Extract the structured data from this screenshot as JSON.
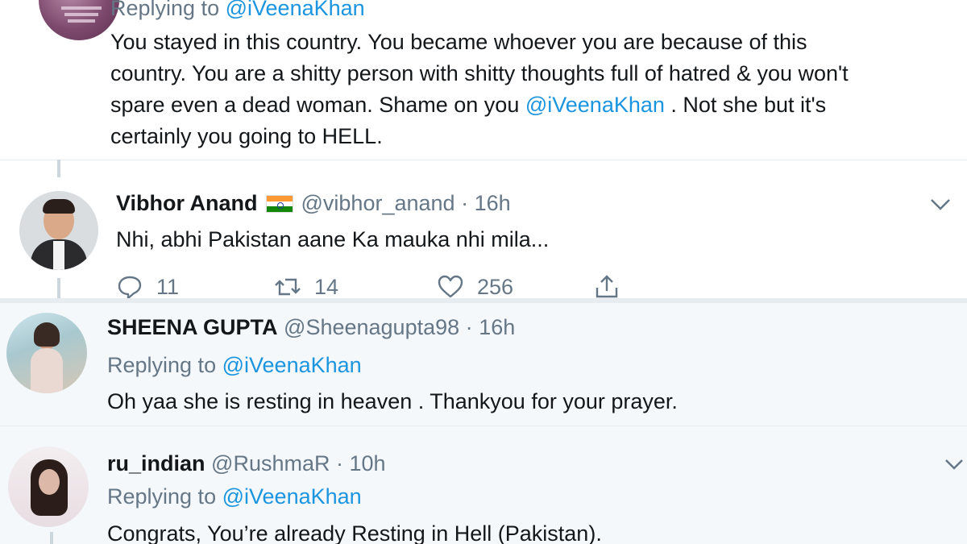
{
  "top_tweet": {
    "replying_prefix": "Replying to",
    "replying_handle": "@iVeenaKhan",
    "text_lines": [
      "You stayed in this country. You became whoever you are because of this",
      "country. You are a shitty person with shitty thoughts full of hatred & you won't",
      "spare even a dead woman. Shame on you ",
      "@iVeenaKhan",
      " . Not she but it's",
      "certainly you going to HELL."
    ]
  },
  "nested_reply": {
    "name": "Vibhor Anand",
    "handle": "@vibhor_anand",
    "separator": "·",
    "time": "16h",
    "text": "Nhi, abhi Pakistan aane Ka mauka nhi mila...",
    "replies": "11",
    "retweets": "14",
    "likes": "256",
    "flag_icon": "india-flag-icon"
  },
  "sheena_tweet": {
    "name": "SHEENA GUPTA",
    "handle": "@Sheenagupta98",
    "separator": "·",
    "time": "16h",
    "replying_prefix": "Replying to",
    "replying_handle": "@iVeenaKhan",
    "text": "Oh yaa she is resting in heaven . Thankyou for your prayer."
  },
  "rushma_tweet": {
    "name": "ru_indian",
    "handle": "@RushmaR",
    "separator": "·",
    "time": "10h",
    "replying_prefix": "Replying to",
    "replying_handle": "@iVeenaKhan",
    "text": "Congrats, You’re already Resting in Hell (Pakistan)."
  },
  "colors": {
    "link": "#1b95e0",
    "muted": "#657786",
    "reply_bg": "#f5f8fa"
  }
}
